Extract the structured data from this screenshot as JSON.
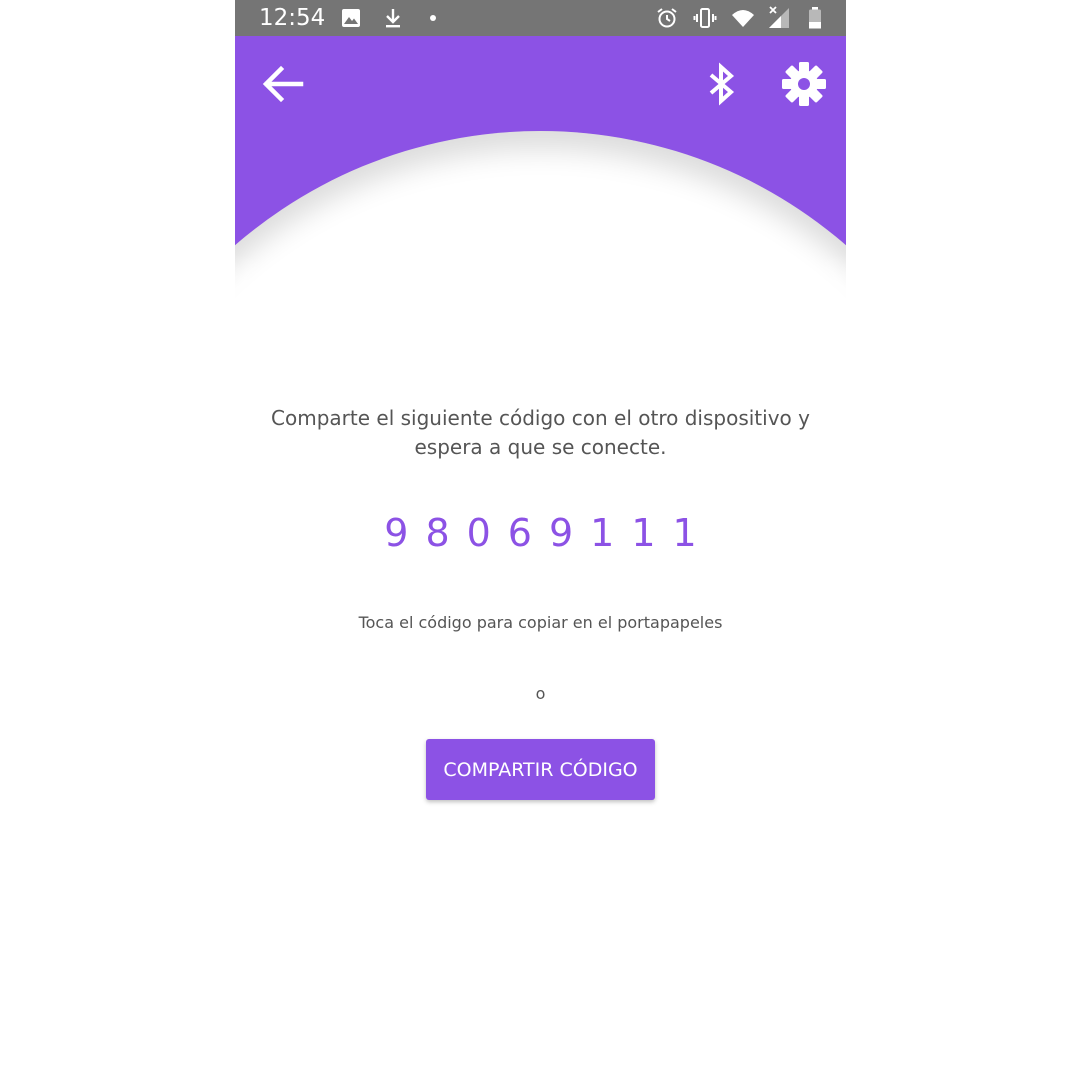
{
  "status_bar": {
    "time": "12:54",
    "left_icons": [
      "image-icon",
      "download-icon",
      "dot-icon"
    ],
    "right_icons": [
      "alarm-icon",
      "vibrate-icon",
      "wifi-icon",
      "signal-icon",
      "battery-icon"
    ]
  },
  "app_bar": {
    "back_icon": "arrow-back-icon",
    "actions": [
      "bluetooth-icon",
      "settings-icon"
    ]
  },
  "main": {
    "instruction": "Comparte el siguiente código con el otro dispositivo y espera a que se conecte.",
    "code": "98069111",
    "hint": "Toca el código para copiar en el portapapeles",
    "or": "o",
    "share_button": "COMPARTIR CÓDIGO"
  },
  "colors": {
    "accent": "#8c52e5",
    "status_bar": "#757575",
    "text": "#555555"
  }
}
